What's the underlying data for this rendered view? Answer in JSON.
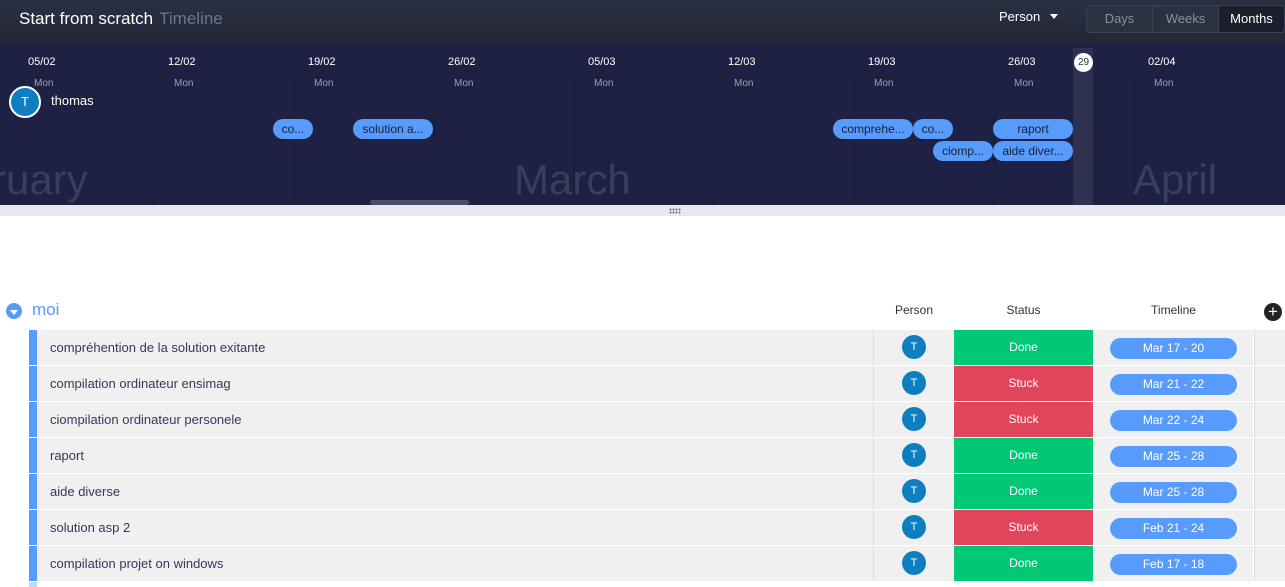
{
  "header": {
    "board_title": "Start from scratch",
    "view_name": "Timeline",
    "group_by_label": "Person",
    "view_modes": [
      "Days",
      "Weeks",
      "Months"
    ],
    "active_view_mode": "Months"
  },
  "timeline": {
    "dates": [
      "05/02",
      "12/02",
      "19/02",
      "26/02",
      "05/03",
      "12/03",
      "19/03",
      "26/03",
      "02/04"
    ],
    "day_label": "Mon",
    "today": "29",
    "months": [
      "ruary",
      "March",
      "April"
    ],
    "owner": {
      "initial": "T",
      "name": "thomas"
    },
    "bars": [
      "co...",
      "solution a...",
      "comprehe...",
      "co...",
      "ciomp...",
      "raport",
      "aide diver..."
    ]
  },
  "table": {
    "group_name": "moi",
    "columns": {
      "person": "Person",
      "status": "Status",
      "timeline": "Timeline"
    },
    "add_column": "+",
    "colors": {
      "done": "#00c875",
      "stuck": "#e2445c",
      "accent": "#579bfc"
    },
    "rows": [
      {
        "name": "compréhention de la solution exitante",
        "person": "T",
        "status": "Done",
        "timeline": "Mar 17 - 20"
      },
      {
        "name": "compilation ordinateur ensimag",
        "person": "T",
        "status": "Stuck",
        "timeline": "Mar 21 - 22"
      },
      {
        "name": "ciompilation ordinateur personele",
        "person": "T",
        "status": "Stuck",
        "timeline": "Mar 22 - 24"
      },
      {
        "name": "raport",
        "person": "T",
        "status": "Done",
        "timeline": "Mar 25 - 28"
      },
      {
        "name": "aide diverse",
        "person": "T",
        "status": "Done",
        "timeline": "Mar 25 - 28"
      },
      {
        "name": "solution asp 2",
        "person": "T",
        "status": "Stuck",
        "timeline": "Feb 21 - 24"
      },
      {
        "name": "compilation projet on windows",
        "person": "T",
        "status": "Done",
        "timeline": "Feb 17 - 18"
      }
    ]
  }
}
